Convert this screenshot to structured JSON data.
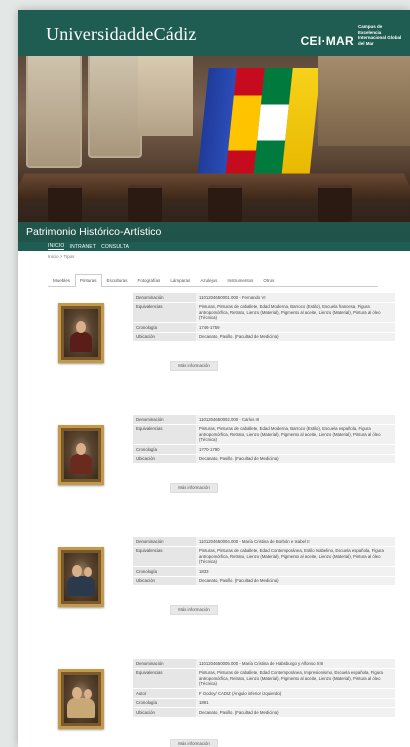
{
  "header": {
    "brand": "UniversidaddeCádiz",
    "cei_mark": "CEI·MAR",
    "cei_text": "Campus de Excelencia Internacional Global del Mar"
  },
  "hero": {
    "title": "Patrimonio Histórico-Artístico"
  },
  "nav": {
    "items": [
      "INICIO",
      "INTRANET",
      "CONSULTA"
    ]
  },
  "breadcrumb": "Inicio > Tipos",
  "tabs": [
    "Muebles",
    "Pinturas",
    "Esculturas",
    "Fotografías",
    "Lámparas",
    "Azulejos",
    "Instrumentos",
    "Otros"
  ],
  "more_label": "Más información",
  "items": [
    {
      "rows": [
        {
          "k": "Denominación",
          "v": "1101204650001.000 - Fernando VI"
        },
        {
          "k": "Equivalencias",
          "v": "Pinturas, Pinturas de caballete, Edad Moderna, Barroco (Estilo), Escuela francesa, Figura antropomórfica, Retrato, Lienzo (Material), Pigmento al aceite, Lienzo (Material), Pintura al óleo (Técnica)"
        },
        {
          "k": "Cronología",
          "v": "1746-1759"
        },
        {
          "k": "Ubicación",
          "v": "Decanato, Pasillo. (Facultad de Medicina)"
        }
      ]
    },
    {
      "rows": [
        {
          "k": "Denominación",
          "v": "1101204650002.000 - Carlos III"
        },
        {
          "k": "Equivalencias",
          "v": "Pinturas, Pinturas de caballete, Edad Moderna, Barroco (Estilo), Escuela española, Figura antropomórfica, Retrato, Lienzo (Material), Pigmento al aceite, Lienzo (Material), Pintura al óleo (Técnica)"
        },
        {
          "k": "Cronología",
          "v": "1770-1790"
        },
        {
          "k": "Ubicación",
          "v": "Decanato, Pasillo. (Facultad de Medicina)"
        }
      ]
    },
    {
      "rows": [
        {
          "k": "Denominación",
          "v": "1101204650004.000 - María Cristina de Borbón e Isabel II"
        },
        {
          "k": "Equivalencias",
          "v": "Pinturas, Pinturas de caballete, Edad Contemporánea, Estilo Isabelino, Escuela española, Figura antropomórfica, Retrato, Lienzo (Material), Pigmento al aceite, Lienzo (Material), Pintura al óleo (Técnica)"
        },
        {
          "k": "Cronología",
          "v": "1833"
        },
        {
          "k": "Ubicación",
          "v": "Decanato, Pasillo. (Facultad de Medicina)"
        }
      ]
    },
    {
      "rows": [
        {
          "k": "Denominación",
          "v": "1101204650005.000 - María Cristina de Habsburgo y Alfonso XIII"
        },
        {
          "k": "Equivalencias",
          "v": "Pinturas, Pinturas de caballete, Edad Contemporánea, Impresionismo, Escuela española, Figura antropomórfica, Retrato, Lienzo (Material), Pigmento al aceite, Lienzo (Material), Pintura al óleo (Técnica)"
        },
        {
          "k": "Autor",
          "v": "F Godoy/ CADIZ (Ángulo inferior izquierdo)"
        },
        {
          "k": "Cronología",
          "v": "1891"
        },
        {
          "k": "Ubicación",
          "v": "Decanato, Pasillo. (Facultad de Medicina)"
        }
      ]
    }
  ]
}
